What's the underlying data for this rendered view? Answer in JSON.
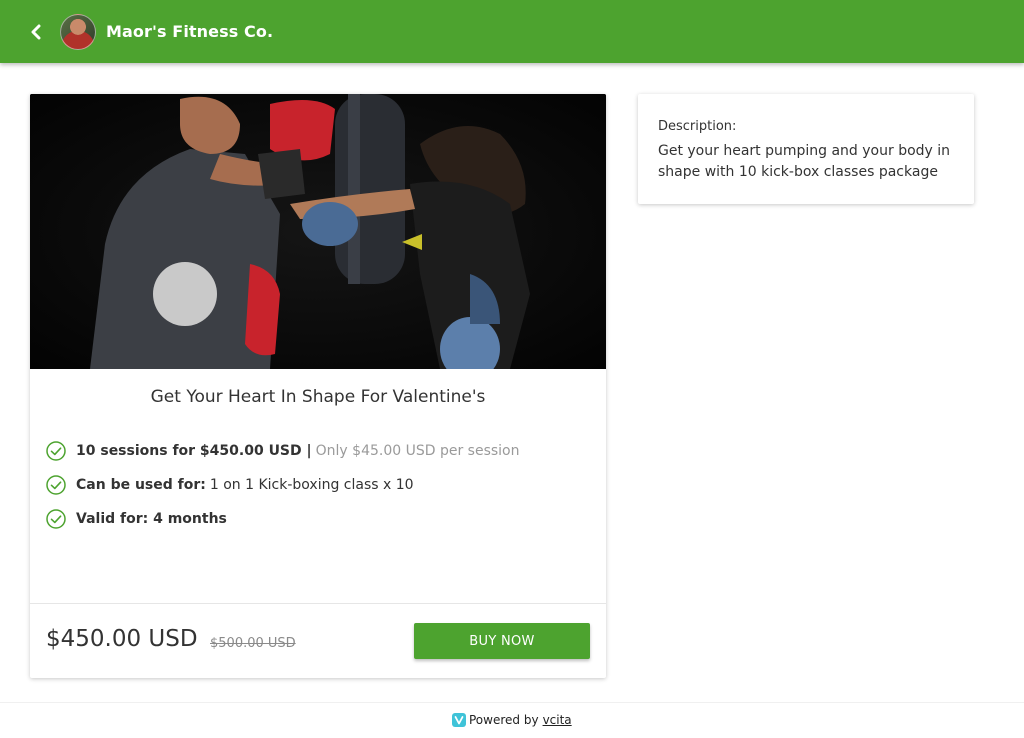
{
  "header": {
    "business_name": "Maor's Fitness Co.",
    "back_icon": "chevron-left-icon",
    "avatar": "business-avatar",
    "bar_color": "#4da32f"
  },
  "package": {
    "title": "Get Your Heart In Shape For Valentine's",
    "hero_image": "kickboxing-photo",
    "features": [
      {
        "label": "10 sessions for $450.00 USD |",
        "value": "",
        "note": "Only $45.00 USD per session"
      },
      {
        "label": "Can be used for:",
        "value": "1 on 1 Kick-boxing class x 10",
        "note": ""
      },
      {
        "label": "Valid for: 4 months",
        "value": "",
        "note": ""
      }
    ],
    "price": "$450.00 USD",
    "original_price": "$500.00 USD",
    "buy_label": "BUY NOW",
    "accent_color": "#4da32f"
  },
  "description": {
    "label": "Description:",
    "text": "Get your heart pumping and your body in shape with 10 kick-box classes package"
  },
  "footer": {
    "powered_by": "Powered by",
    "brand_link": "vcita"
  }
}
